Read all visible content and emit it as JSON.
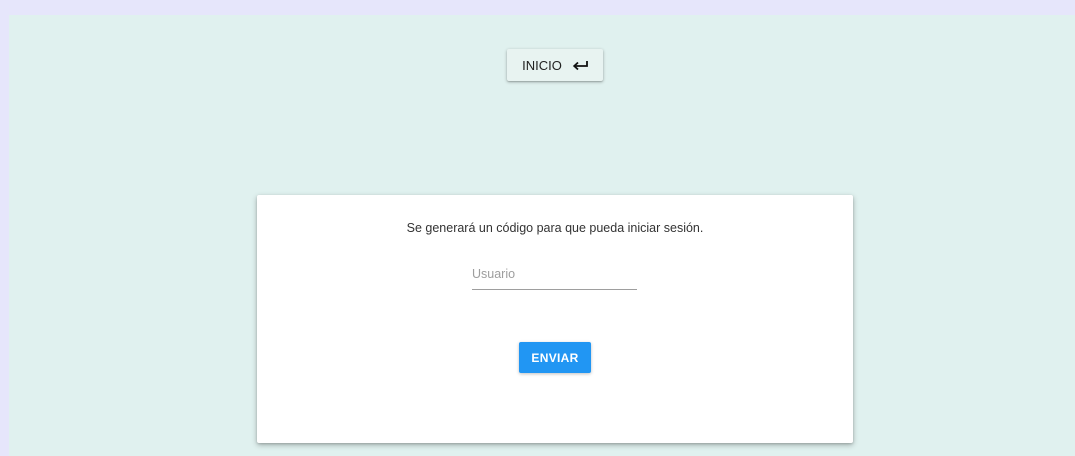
{
  "header": {
    "home_label": "INICIO",
    "home_icon": "return-arrow-icon"
  },
  "login_card": {
    "message": "Se generará un código para que pueda iniciar sesión.",
    "username": {
      "placeholder": "Usuario",
      "value": ""
    },
    "submit_label": "ENVIAR"
  },
  "colors": {
    "page_border": "#e6e6fb",
    "background": "#e0f1ef",
    "card": "#ffffff",
    "primary": "#2196f3"
  }
}
